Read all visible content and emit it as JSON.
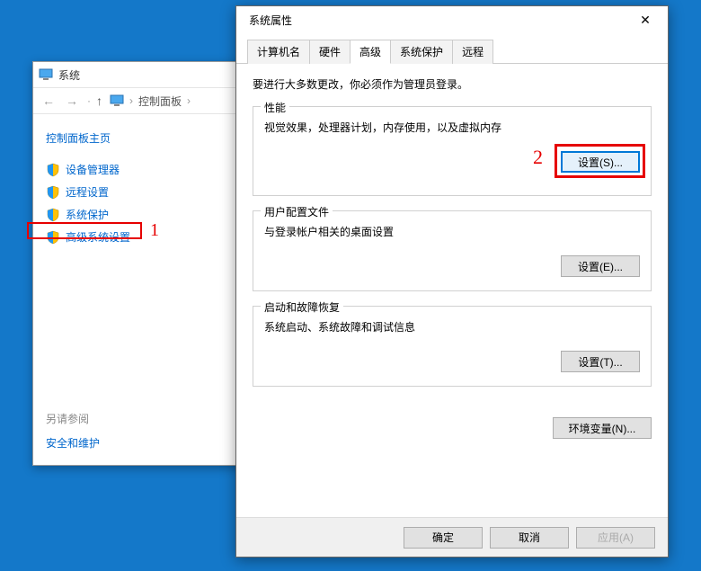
{
  "system_window": {
    "title": "系统",
    "breadcrumb": "控制面板",
    "sidebar": {
      "heading": "控制面板主页",
      "items": [
        {
          "label": "设备管理器"
        },
        {
          "label": "远程设置"
        },
        {
          "label": "系统保护"
        },
        {
          "label": "高级系统设置"
        }
      ]
    },
    "see_also": {
      "label": "另请参阅",
      "link": "安全和维护"
    }
  },
  "props_dialog": {
    "title": "系统属性",
    "tabs": [
      {
        "label": "计算机名"
      },
      {
        "label": "硬件"
      },
      {
        "label": "高级"
      },
      {
        "label": "系统保护"
      },
      {
        "label": "远程"
      }
    ],
    "admin_note": "要进行大多数更改，你必须作为管理员登录。",
    "groups": {
      "performance": {
        "title": "性能",
        "desc": "视觉效果，处理器计划，内存使用，以及虚拟内存",
        "button": "设置(S)..."
      },
      "user_profile": {
        "title": "用户配置文件",
        "desc": "与登录帐户相关的桌面设置",
        "button": "设置(E)..."
      },
      "startup": {
        "title": "启动和故障恢复",
        "desc": "系统启动、系统故障和调试信息",
        "button": "设置(T)..."
      }
    },
    "env_vars_button": "环境变量(N)...",
    "footer": {
      "ok": "确定",
      "cancel": "取消",
      "apply": "应用(A)"
    }
  },
  "annotations": {
    "one": "1",
    "two": "2"
  }
}
